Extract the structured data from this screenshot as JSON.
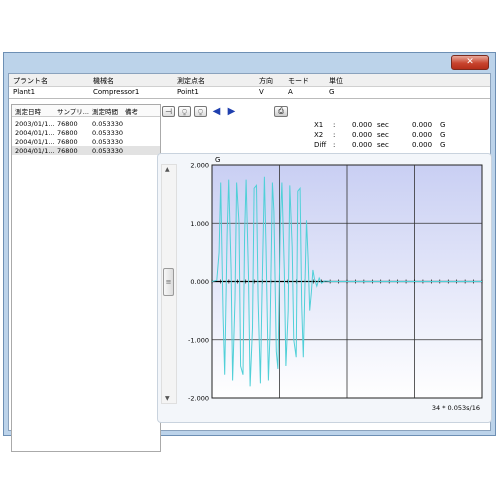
{
  "window": {
    "close_label": "✕"
  },
  "header": {
    "columns": [
      {
        "label": "プラント名",
        "value": "Plant1"
      },
      {
        "label": "機械名",
        "value": "Compressor1"
      },
      {
        "label": "測定点名",
        "value": "Point1"
      },
      {
        "label": "方向",
        "value": "V"
      },
      {
        "label": "モード",
        "value": "A"
      },
      {
        "label": "単位",
        "value": "G"
      }
    ]
  },
  "list": {
    "headers": [
      "測定日時",
      "サンプリ...",
      "測定時間",
      "備考"
    ],
    "rows": [
      [
        "2003/01/1...",
        "76800",
        "0.053330",
        ""
      ],
      [
        "2004/01/1...",
        "76800",
        "0.053330",
        ""
      ],
      [
        "2004/01/1...",
        "76800",
        "0.053330",
        ""
      ],
      [
        "2004/01/1...",
        "76800",
        "0.053330",
        ""
      ]
    ],
    "selected_index": 3
  },
  "toolbar": {
    "buttons": [
      {
        "icon": "cursor-icon",
        "glyph": "⊣"
      },
      {
        "icon": "zoom-in-icon",
        "glyph": "⍜"
      },
      {
        "icon": "zoom-out-icon",
        "glyph": "⍜"
      },
      {
        "icon": "prev-icon",
        "glyph": "◀"
      },
      {
        "icon": "next-icon",
        "glyph": "▶"
      }
    ],
    "print_icon": "printer-icon"
  },
  "cursor_info": [
    {
      "label": "X1",
      "sep": ":",
      "time": "0.000",
      "time_unit": "sec",
      "value": "0.000",
      "value_unit": "G"
    },
    {
      "label": "X2",
      "sep": ":",
      "time": "0.000",
      "time_unit": "sec",
      "value": "0.000",
      "value_unit": "G"
    },
    {
      "label": "Diff",
      "sep": ":",
      "time": "0.000",
      "time_unit": "sec",
      "value": "0.000",
      "value_unit": "G"
    }
  ],
  "chart_data": {
    "type": "line",
    "ylabel": "G",
    "ylim": [
      -2.0,
      2.0
    ],
    "ytick_labels": [
      "2.000",
      "1.000",
      "0.000",
      "-1.000",
      "-2.000"
    ],
    "xlim": [
      0,
      34
    ],
    "footer": "34 * 0.053s/16",
    "grid": true,
    "line_color": "#50d0d8",
    "plot_bg_top": "#c9cff3",
    "plot_bg_bottom": "#ffffff",
    "series": [
      {
        "values": [
          [
            0.0,
            0.0
          ],
          [
            0.6,
            0.02
          ],
          [
            0.9,
            0.5
          ],
          [
            1.1,
            1.7
          ],
          [
            1.4,
            -0.6
          ],
          [
            1.6,
            -1.6
          ],
          [
            1.9,
            0.8
          ],
          [
            2.1,
            1.75
          ],
          [
            2.4,
            0.2
          ],
          [
            2.6,
            -1.7
          ],
          [
            2.9,
            -0.3
          ],
          [
            3.1,
            1.7
          ],
          [
            3.4,
            1.0
          ],
          [
            3.6,
            -1.45
          ],
          [
            3.9,
            -1.6
          ],
          [
            4.1,
            0.8
          ],
          [
            4.3,
            1.75
          ],
          [
            4.6,
            0.1
          ],
          [
            4.8,
            -1.8
          ],
          [
            5.1,
            -0.8
          ],
          [
            5.3,
            1.6
          ],
          [
            5.6,
            1.65
          ],
          [
            5.8,
            -0.3
          ],
          [
            6.1,
            -1.75
          ],
          [
            6.3,
            -0.2
          ],
          [
            6.6,
            1.8
          ],
          [
            6.8,
            0.6
          ],
          [
            7.1,
            -1.7
          ],
          [
            7.3,
            -0.9
          ],
          [
            7.6,
            1.7
          ],
          [
            7.8,
            1.2
          ],
          [
            8.1,
            -1.2
          ],
          [
            8.3,
            -1.5
          ],
          [
            8.6,
            1.0
          ],
          [
            8.8,
            1.7
          ],
          [
            9.1,
            0.2
          ],
          [
            9.3,
            -1.45
          ],
          [
            9.6,
            -0.5
          ],
          [
            9.8,
            1.65
          ],
          [
            10.1,
            0.6
          ],
          [
            10.3,
            -1.0
          ],
          [
            10.6,
            -1.3
          ],
          [
            10.8,
            1.55
          ],
          [
            11.1,
            1.6
          ],
          [
            11.3,
            -0.4
          ],
          [
            11.5,
            -1.3
          ],
          [
            11.7,
            -0.1
          ],
          [
            11.9,
            1.05
          ],
          [
            12.1,
            0.4
          ],
          [
            12.3,
            -0.5
          ],
          [
            12.5,
            -0.2
          ],
          [
            12.7,
            0.2
          ],
          [
            12.9,
            0.05
          ],
          [
            13.2,
            -0.08
          ],
          [
            13.5,
            0.06
          ],
          [
            13.8,
            -0.03
          ],
          [
            14.2,
            0.01
          ],
          [
            15.0,
            0.0
          ],
          [
            34.0,
            0.0
          ]
        ]
      }
    ]
  }
}
